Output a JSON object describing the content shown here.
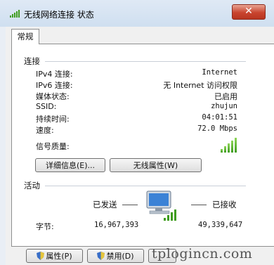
{
  "window": {
    "title": "无线网络连接 状态",
    "close_glyph": "✕"
  },
  "tabs": [
    {
      "label": "常规"
    }
  ],
  "connection": {
    "group_label": "连接",
    "rows": [
      {
        "label": "IPv4 连接:",
        "value": "Internet"
      },
      {
        "label": "IPv6 连接:",
        "value": "无 Internet 访问权限"
      },
      {
        "label": "媒体状态:",
        "value": "已启用"
      },
      {
        "label": "SSID:",
        "value": "zhujun"
      },
      {
        "label": "持续时间:",
        "value": "04:01:51"
      },
      {
        "label": "速度:",
        "value": "72.0 Mbps"
      }
    ],
    "signal_label": "信号质量:",
    "signal_bars": 5,
    "details_button": "详细信息(E)...",
    "wireless_props_button": "无线属性(W)"
  },
  "activity": {
    "group_label": "活动",
    "sent_label": "已发送",
    "received_label": "已接收",
    "bytes_label": "字节:",
    "bytes_sent": "16,967,393",
    "bytes_received": "49,339,647"
  },
  "footer": {
    "properties_button": "属性(P)",
    "disable_button": "禁用(D)"
  },
  "watermark": "tplogincn.com",
  "colors": {
    "signal": "#3e9c1d",
    "close": "#c9452f",
    "title_bg": "#cfdff0"
  }
}
